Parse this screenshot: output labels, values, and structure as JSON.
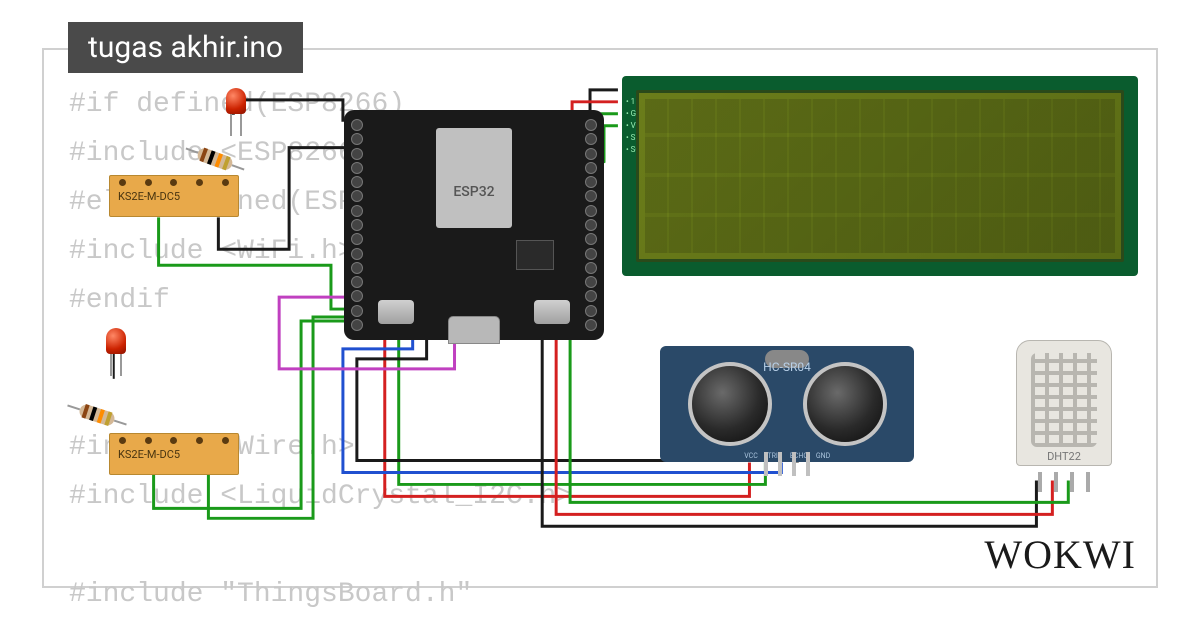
{
  "title": "tugas akhir.ino",
  "brand": "WOKWI",
  "code_lines": [
    "#if defined(ESP8266)",
    "#include <ESP8266WiFi.h>",
    "#elif defined(ESP32)",
    "#include <WiFi.h>",
    "#endif",
    "",
    "",
    "#include <Wire.h>",
    "#include <LiquidCrystal_I2C.h>",
    "",
    "#include \"ThingsBoard.h\""
  ],
  "components": {
    "esp32": {
      "label": "ESP32"
    },
    "lcd": {
      "i2c_pins": [
        "1",
        "GND",
        "VCC",
        "SDA",
        "SCL"
      ]
    },
    "relay1": {
      "label": "KS2E-M-DC5"
    },
    "relay2": {
      "label": "KS2E-M-DC5"
    },
    "hcsr04": {
      "label": "HC-SR04",
      "pins": [
        "VCC",
        "TRIG",
        "ECHO",
        "GND"
      ]
    },
    "dht22": {
      "label": "DHT22"
    }
  },
  "wire_colors": {
    "gnd": "#1a1a1a",
    "vcc": "#d42020",
    "sda": "#1a9a1a",
    "scl": "#1a9a1a",
    "sig1": "#c040c0",
    "sig2": "#2050d0",
    "sig3": "#1a9a1a"
  }
}
